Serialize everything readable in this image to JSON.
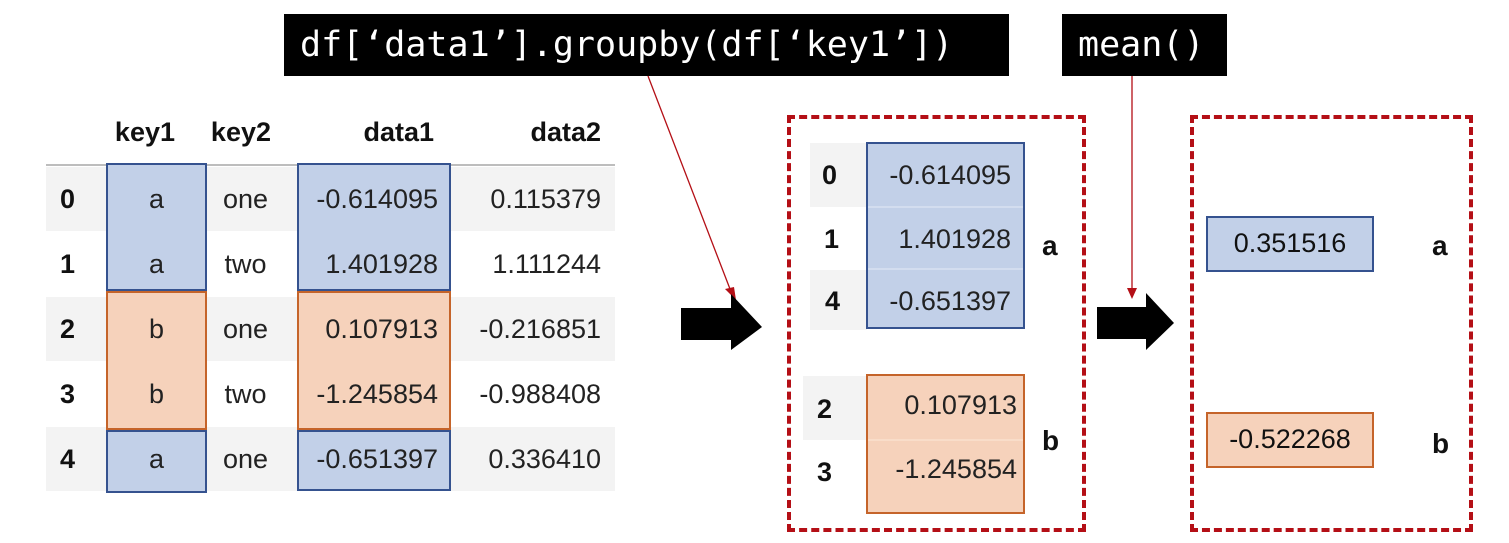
{
  "code": {
    "groupby": "df[‘data1’].groupby(df[‘key1’])",
    "mean": "mean()"
  },
  "table": {
    "columns": [
      "key1",
      "key2",
      "data1",
      "data2"
    ],
    "rows": [
      {
        "index": "0",
        "key1": "a",
        "key2": "one",
        "data1": "-0.614095",
        "data2": "0.115379"
      },
      {
        "index": "1",
        "key1": "a",
        "key2": "two",
        "data1": "1.401928",
        "data2": "1.111244"
      },
      {
        "index": "2",
        "key1": "b",
        "key2": "one",
        "data1": "0.107913",
        "data2": "-0.216851"
      },
      {
        "index": "3",
        "key1": "b",
        "key2": "two",
        "data1": "-1.245854",
        "data2": "-0.988408"
      },
      {
        "index": "4",
        "key1": "a",
        "key2": "one",
        "data1": "-0.651397",
        "data2": "0.336410"
      }
    ]
  },
  "groups": [
    {
      "key": "a",
      "color": "#c2d0e8",
      "rows": [
        {
          "index": "0",
          "value": "-0.614095"
        },
        {
          "index": "1",
          "value": "1.401928"
        },
        {
          "index": "4",
          "value": "-0.651397"
        }
      ]
    },
    {
      "key": "b",
      "color": "#f6d2bb",
      "rows": [
        {
          "index": "2",
          "value": "0.107913"
        },
        {
          "index": "3",
          "value": "-1.245854"
        }
      ]
    }
  ],
  "results": [
    {
      "key": "a",
      "value": "0.351516"
    },
    {
      "key": "b",
      "value": "-0.522268"
    }
  ],
  "colors": {
    "blue_fill": "#c2d0e8",
    "blue_border": "#35528f",
    "orange_fill": "#f6d2bb",
    "orange_border": "#c5642a",
    "dashed_border": "#b40f16",
    "arrow_line": "#b40f16"
  }
}
